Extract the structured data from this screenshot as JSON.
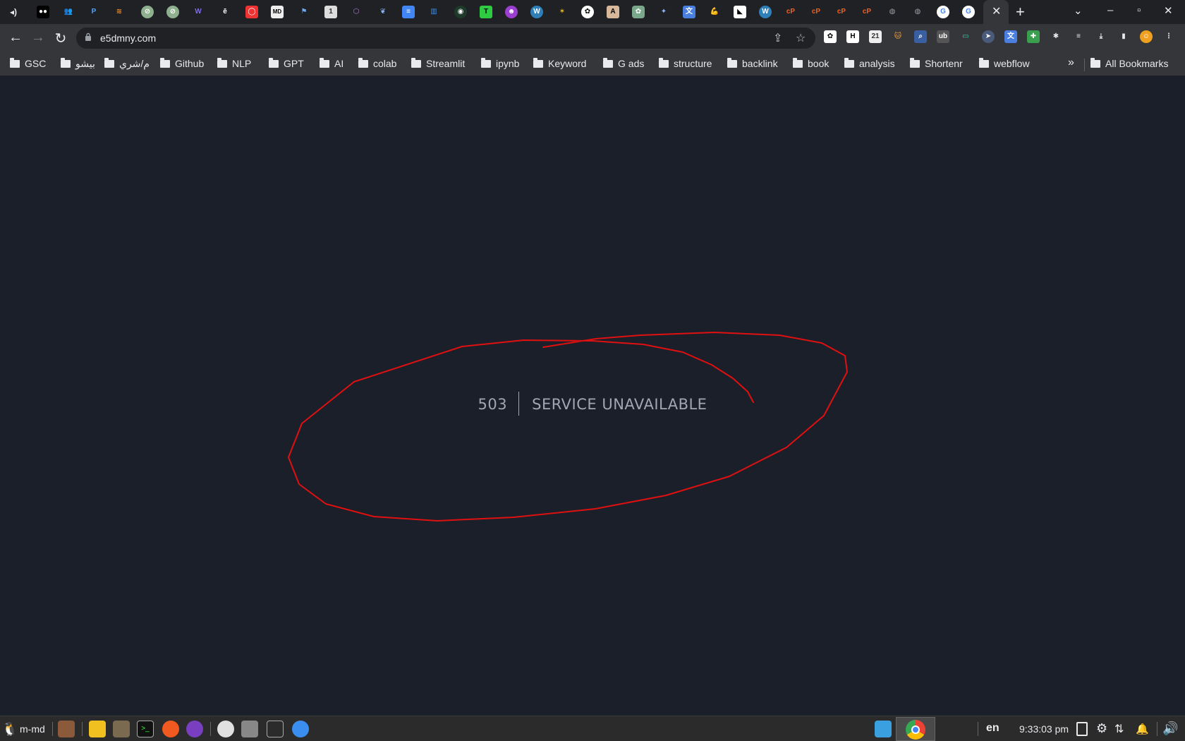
{
  "browser": {
    "url": "e5dmny.com",
    "tabs": {
      "favicons": [
        "audio-tab",
        "medium",
        "teams",
        "paypal",
        "rocket",
        "link",
        "link",
        "word",
        "letter-e",
        "opera",
        "md-html",
        "flag",
        "one-sign",
        "hexagon",
        "feather",
        "docs",
        "libraries",
        "openai",
        "t-green",
        "purple-circle",
        "wordpress",
        "bees",
        "openai",
        "anthropic",
        "chatgpt",
        "sparkle",
        "translate",
        "muscle",
        "duck",
        "wordpress",
        "cpanel",
        "cpanel",
        "cpanel",
        "cpanel",
        "globe",
        "globe",
        "google",
        "google"
      ],
      "active_close": "✕",
      "new_tab": "+"
    },
    "window_controls": {
      "dropdown": "⌄",
      "minimize": "–",
      "maximize": "▫",
      "close": "✕"
    },
    "nav": {
      "back": "←",
      "forward": "→",
      "reload": "↻"
    },
    "omnibox": {
      "share": "⇪",
      "star": "☆"
    },
    "bookmarks": [
      {
        "label": "GSC"
      },
      {
        "label": "بيشو"
      },
      {
        "label": "م/شري"
      },
      {
        "label": "Github"
      },
      {
        "label": "NLP"
      },
      {
        "label": "GPT"
      },
      {
        "label": "AI"
      },
      {
        "label": "colab"
      },
      {
        "label": "Streamlit"
      },
      {
        "label": "ipynb"
      },
      {
        "label": "Keyword"
      },
      {
        "label": "G ads"
      },
      {
        "label": "structure"
      },
      {
        "label": "backlink"
      },
      {
        "label": "book"
      },
      {
        "label": "analysis"
      },
      {
        "label": "Shortenr"
      },
      {
        "label": "webflow"
      }
    ],
    "bookmarks_more": "»",
    "all_bookmarks": "All Bookmarks"
  },
  "page": {
    "error_code": "503",
    "error_message": "SERVICE UNAVAILABLE"
  },
  "taskbar": {
    "start_label": "m-md",
    "language": "en",
    "clock": "9:33:03 pm"
  },
  "colors": {
    "page_bg": "#1b1f2a",
    "error_text": "#a0a6b4",
    "annotation": "#e01010"
  }
}
